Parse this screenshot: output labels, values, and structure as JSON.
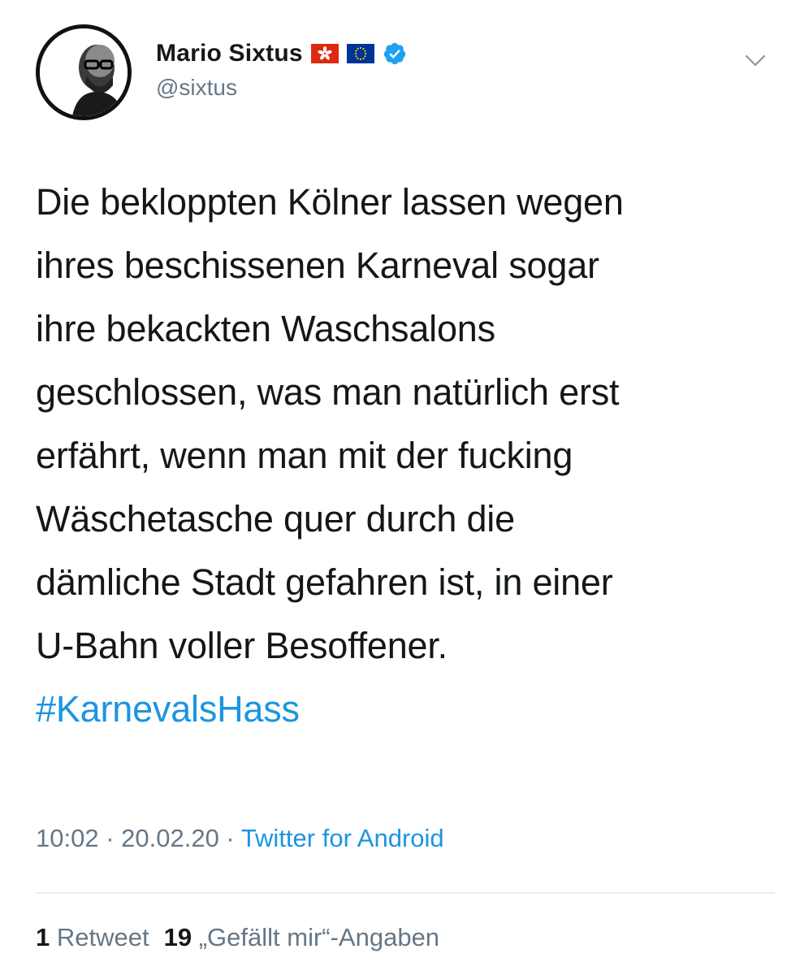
{
  "author": {
    "display_name": "Mario Sixtus",
    "handle": "@sixtus",
    "verified": true,
    "flags": [
      "hong-kong-flag",
      "eu-flag"
    ]
  },
  "tweet": {
    "lines": [
      "Die bekloppten Kölner lassen wegen",
      "ihres beschissenen Karneval sogar",
      "ihre bekackten Waschsalons",
      "geschlossen, was man natürlich erst",
      "erfährt, wenn man mit der fucking",
      "Wäschetasche quer durch die",
      "dämliche Stadt gefahren ist, in einer",
      "U-Bahn voller Besoffener."
    ],
    "hashtag": "#KarnevalsHass"
  },
  "meta": {
    "time": "10:02",
    "separator": " · ",
    "date": "20.02.20",
    "source": "Twitter for Android"
  },
  "stats": {
    "retweet_count": "1",
    "retweet_label": "Retweet",
    "like_count": "19",
    "like_label": "„Gefällt mir“-Angaben"
  },
  "colors": {
    "text": "#14171a",
    "secondary": "#657786",
    "link": "#1b95e0",
    "divider": "#e6ecf0",
    "verified": "#1da1f2"
  }
}
